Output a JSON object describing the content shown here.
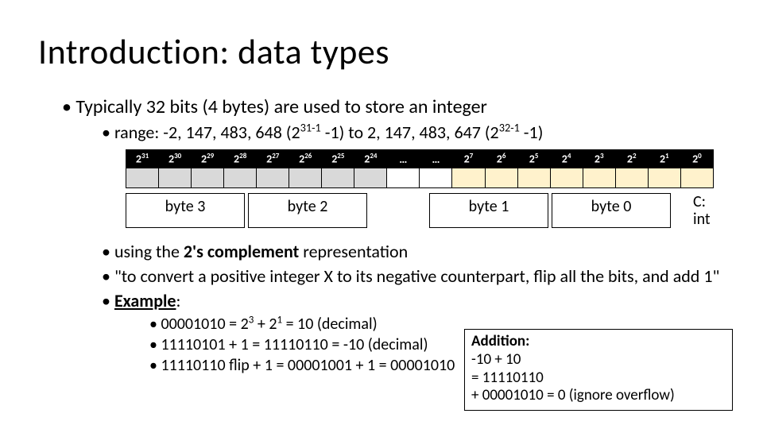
{
  "title": "Introduction: data types",
  "bullets": {
    "l1a": "Typically 32 bits (4 bytes) are used to store an integer",
    "l2a_pre": "range: -2, 147, 483, 648 (2",
    "l2a_sup1": "31-1",
    "l2a_mid": " -1) to 2, 147, 483, 647 (2",
    "l2a_sup2": "32-1",
    "l2a_post": " -1)",
    "l2b_pre": "using the ",
    "l2b_strong": "2's complement",
    "l2b_post": " representation",
    "l2c": "\"to convert a positive integer X to its negative counterpart, flip all the bits, and add 1\"",
    "l2d_pre": "",
    "l2d_strong": "Example",
    "l2d_post": ":",
    "l3a_pre": "00001010 = 2",
    "l3a_sup1": "3",
    "l3a_mid": " + 2",
    "l3a_sup2": "1",
    "l3a_post": " = 10 (decimal)",
    "l3b": "11110101 + 1 = 11110110 = -10 (decimal)",
    "l3c": "11110110 flip + 1 = 00001001 + 1 = 00001010"
  },
  "bits_header": {
    "exps_left": [
      "31",
      "30",
      "29",
      "28",
      "27",
      "26",
      "25",
      "24"
    ],
    "ellipsis": "…",
    "exps_right": [
      "7",
      "6",
      "5",
      "4",
      "3",
      "2",
      "1",
      "0"
    ]
  },
  "byte_labels": [
    "byte 3",
    "byte 2",
    "byte 1",
    "byte 0"
  ],
  "c_label_l1": "C:",
  "c_label_l2": "int",
  "addition": {
    "title": "Addition:",
    "l1": "-10 + 10",
    "l2": "= 11110110",
    "l3": "+ 00001010 = 0 (ignore overflow)"
  }
}
